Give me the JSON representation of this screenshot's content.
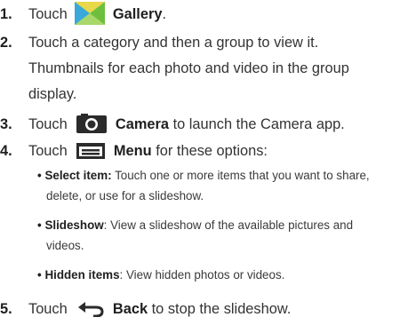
{
  "steps": [
    {
      "num": "1.",
      "prefix": "Touch",
      "icon": "gallery-icon",
      "label": "Gallery",
      "suffix": "."
    },
    {
      "num": "2.",
      "text": "Touch a category and then a group to view it.",
      "extra_lines": [
        "Thumbnails for each photo and video in the group",
        "display."
      ]
    },
    {
      "num": "3.",
      "prefix": "Touch",
      "icon": "camera-icon",
      "label": "Camera",
      "suffix": " to launch the Camera app."
    },
    {
      "num": "4.",
      "prefix": "Touch",
      "icon": "menu-icon",
      "label": "Menu",
      "suffix": " for these options:"
    },
    {
      "num": "5.",
      "prefix": "Touch",
      "icon": "back-icon",
      "label": "Back",
      "suffix": " to stop the slideshow."
    }
  ],
  "options": [
    {
      "term": "Select item:",
      "desc": " Touch one or more items that you want to share,",
      "cont": "delete, or use for a slideshow."
    },
    {
      "term": "Slideshow",
      "desc": ": View a slideshow of the available pictures and",
      "cont": "videos."
    },
    {
      "term": "Hidden items",
      "desc": ": View hidden photos or videos."
    }
  ],
  "bullet_char": "•",
  "colors": {
    "icon_dark": "#2b2b2b",
    "gallery_yellow": "#e8d84a",
    "gallery_green": "#6fbf3e",
    "gallery_blue": "#3aa8d8"
  }
}
